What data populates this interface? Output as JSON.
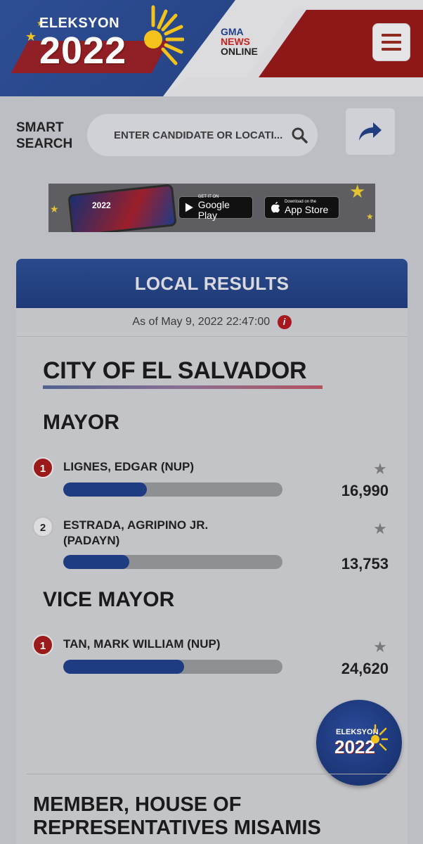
{
  "header": {
    "logo_eleksyon": "ELEKSYON",
    "logo_year": "2022",
    "gma_line1": "GMA",
    "gma_line2": "NEWS",
    "gma_line3": "ONLINE",
    "colors": {
      "blue": "#2e4e94",
      "red": "#8e1818"
    }
  },
  "search": {
    "label_line1": "SMART",
    "label_line2": "SEARCH",
    "placeholder": "ENTER CANDIDATE OR LOCATI..."
  },
  "banner": {
    "phone_text": "2022",
    "google_small": "GET IT ON",
    "google_big": "Google Play",
    "apple_small": "Download on the",
    "apple_big": "App Store"
  },
  "results": {
    "header": "LOCAL RESULTS",
    "as_of": "As of May 9, 2022 22:47:00",
    "info_glyph": "i",
    "city": "CITY OF EL SALVADOR",
    "positions": [
      {
        "title": "MAYOR",
        "candidates": [
          {
            "rank": "1",
            "name_line1": "LIGNES, EDGAR (NUP)",
            "name_line2": "",
            "votes": "16,990",
            "share": 0.38
          },
          {
            "rank": "2",
            "name_line1": "ESTRADA, AGRIPINO JR.",
            "name_line2": "(PADAYN)",
            "votes": "13,753",
            "share": 0.3
          }
        ]
      },
      {
        "title": "VICE MAYOR",
        "candidates": [
          {
            "rank": "1",
            "name_line1": "TAN, MARK WILLIAM (NUP)",
            "name_line2": "",
            "votes": "24,620",
            "share": 0.55
          }
        ]
      }
    ],
    "next_section_title": "MEMBER, HOUSE OF REPRESENTATIVES MISAMIS"
  },
  "fab": {
    "eleksyon": "ELEKSYON",
    "year": "2022"
  }
}
